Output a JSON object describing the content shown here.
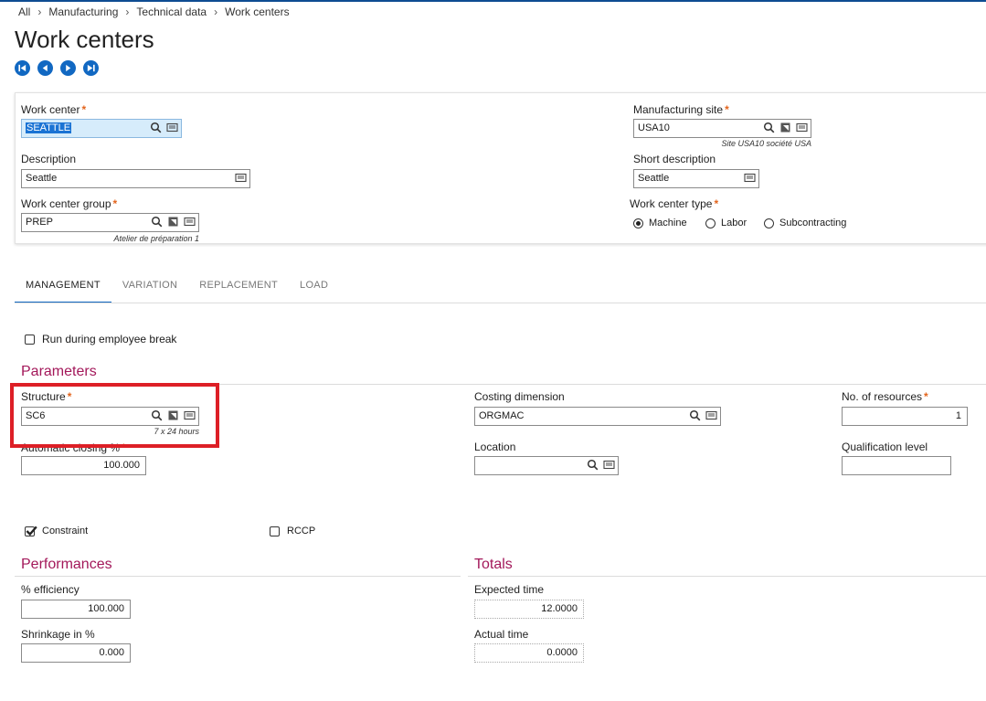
{
  "breadcrumb": {
    "items": [
      "All",
      "Manufacturing",
      "Technical data",
      "Work centers"
    ]
  },
  "page_title": "Work centers",
  "nav_icons": [
    "first-record-icon",
    "previous-record-icon",
    "next-record-icon",
    "last-record-icon"
  ],
  "header": {
    "work_center": {
      "label": "Work center",
      "value": "SEATTLE"
    },
    "description": {
      "label": "Description",
      "value": "Seattle"
    },
    "work_center_group": {
      "label": "Work center group",
      "value": "PREP",
      "hint": "Atelier de préparation 1"
    },
    "manufacturing_site": {
      "label": "Manufacturing site",
      "value": "USA10",
      "hint": "Site USA10 société USA"
    },
    "short_description": {
      "label": "Short description",
      "value": "Seattle"
    },
    "work_center_type": {
      "label": "Work center type",
      "options": [
        "Machine",
        "Labor",
        "Subcontracting"
      ],
      "selected": "Machine"
    }
  },
  "tabs": [
    "MANAGEMENT",
    "VARIATION",
    "REPLACEMENT",
    "LOAD"
  ],
  "active_tab": "MANAGEMENT",
  "management": {
    "run_during_break": {
      "label": "Run during employee break",
      "checked": false
    },
    "parameters": {
      "title": "Parameters",
      "structure": {
        "label": "Structure",
        "value": "SC6",
        "hint": "7 x 24 hours"
      },
      "automatic_closing": {
        "label": "Automatic closing %",
        "value": "100.000"
      },
      "costing_dimension": {
        "label": "Costing dimension",
        "value": "ORGMAC"
      },
      "location": {
        "label": "Location",
        "value": ""
      },
      "no_of_resources": {
        "label": "No. of resources",
        "value": "1"
      },
      "qualification_level": {
        "label": "Qualification level",
        "value": ""
      },
      "constraint": {
        "label": "Constraint",
        "checked": true
      },
      "rccp": {
        "label": "RCCP",
        "checked": false
      }
    },
    "performances": {
      "title": "Performances",
      "efficiency": {
        "label": "% efficiency",
        "value": "100.000"
      },
      "shrinkage": {
        "label": "Shrinkage in %",
        "value": "0.000"
      }
    },
    "totals": {
      "title": "Totals",
      "expected_time": {
        "label": "Expected time",
        "value": "12.0000"
      },
      "actual_time": {
        "label": "Actual time",
        "value": "0.0000"
      }
    }
  },
  "colors": {
    "accent": "#1168c2",
    "section_title": "#a3185a",
    "required": "#e3651d",
    "highlight_box": "#dd1f26"
  }
}
